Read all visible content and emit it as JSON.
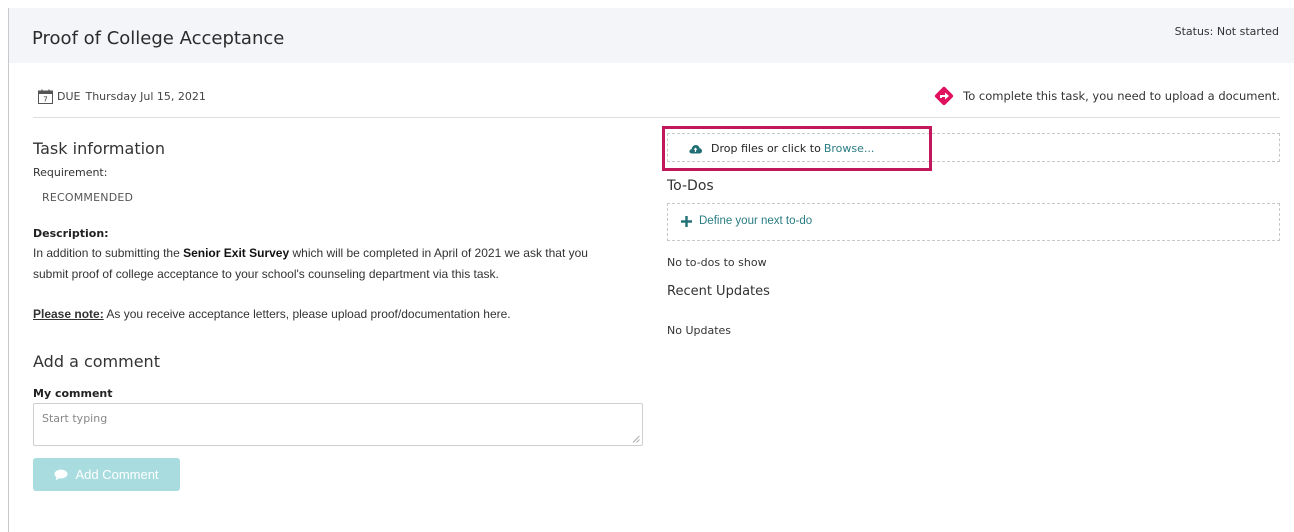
{
  "header": {
    "title": "Proof of College Acceptance",
    "status": "Status: Not started"
  },
  "due": {
    "label": "DUE",
    "date": "Thursday Jul 15, 2021"
  },
  "notice": {
    "text": "To complete this task, you need to upload a document.",
    "icon": "diamond-arrow-icon",
    "color": "#e0115f"
  },
  "task_info": {
    "heading": "Task information",
    "requirement_label": "Requirement:",
    "requirement_value": "RECOMMENDED",
    "description_label": "Description:",
    "description_line1_prefix": "In addition to submitting the ",
    "description_line1_bold": "Senior Exit Survey",
    "description_line1_suffix": " which will be completed in April of 2021 we ask that you",
    "description_line2": "submit proof of college acceptance to your school's counseling department via this task.",
    "note_label": "Please note:",
    "note_text": " As you receive acceptance letters, please upload proof/documentation here."
  },
  "comment": {
    "heading": "Add a comment",
    "field_label": "My comment",
    "placeholder": "Start typing",
    "button_label": "Add Comment"
  },
  "upload": {
    "prompt": "Drop files or click to",
    "browse_label": "Browse..."
  },
  "todos": {
    "heading": "To-Dos",
    "define_label": "Define your next to-do",
    "empty_text": "No to-dos to show"
  },
  "updates": {
    "heading": "Recent Updates",
    "empty_text": "No Updates"
  },
  "colors": {
    "accent": "#2a7d83",
    "highlight": "#c2185b",
    "button_disabled": "#a8dcdf"
  }
}
